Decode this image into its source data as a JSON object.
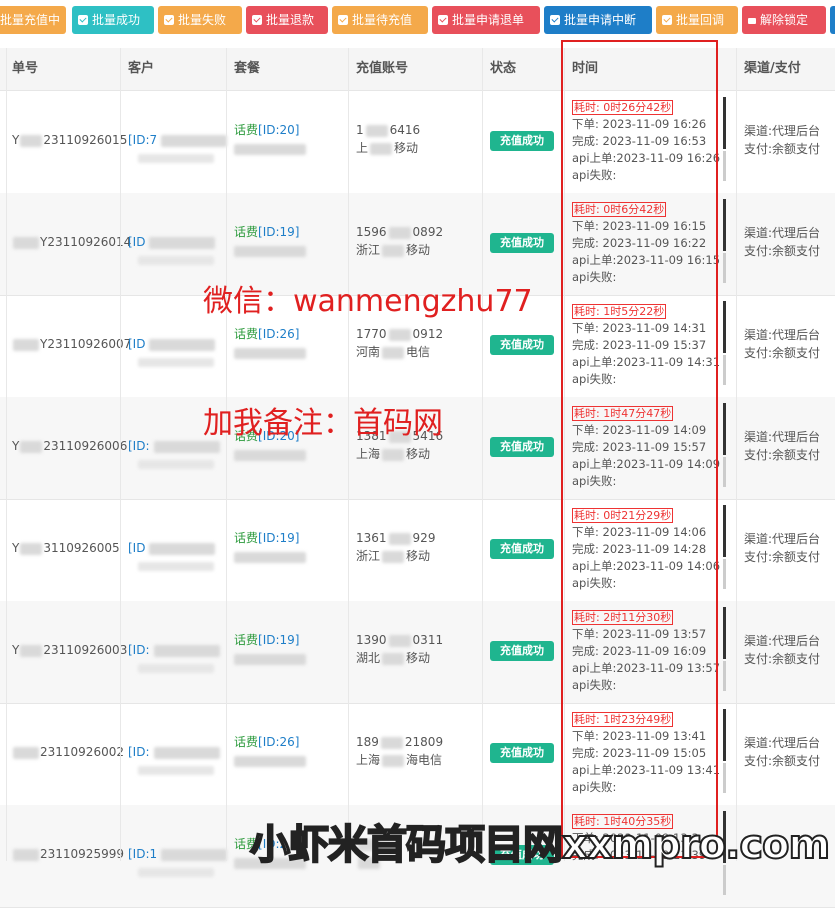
{
  "toolbar": {
    "buttons": [
      {
        "label": "批量充值中",
        "color": "#f4a94a",
        "icon": "check-icon"
      },
      {
        "label": "批量成功",
        "color": "#2ec0c4",
        "icon": "check-icon"
      },
      {
        "label": "批量失败",
        "color": "#f4a94a",
        "icon": "check-icon"
      },
      {
        "label": "批量退款",
        "color": "#e8505b",
        "icon": "check-icon"
      },
      {
        "label": "批量待充值",
        "color": "#f4a94a",
        "icon": "check-icon"
      },
      {
        "label": "批量申请退单",
        "color": "#e8505b",
        "icon": "check-icon"
      },
      {
        "label": "批量申请中断",
        "color": "#1e7ec8",
        "icon": "check-icon"
      },
      {
        "label": "批量回调",
        "color": "#f4a94a",
        "icon": "check-icon"
      },
      {
        "label": "解除锁定",
        "color": "#e8505b",
        "icon": "unlock-icon"
      }
    ]
  },
  "columns": [
    "单号",
    "客户",
    "套餐",
    "充值账号",
    "状态",
    "时间",
    "渠道/支付"
  ],
  "rows": [
    {
      "order_prefix": "Y",
      "order_suffix": "23110926015",
      "customer": "[ID:7",
      "pkg_type": "话费",
      "pkg_id": "[ID:20]",
      "acct1_a": "1",
      "acct1_b": "6",
      "acct1_c": "416",
      "acct2_a": "上",
      "acct2_b": "移动",
      "status": "充值成功",
      "duration": "耗时: 0时26分42秒",
      "order_time": "下单: 2023-11-09 16:26",
      "done_time": "完成: 2023-11-09 16:53",
      "api_time": "api上单:2023-11-09 16:26",
      "api_fail": "api失败:",
      "channel": "渠道:代理后台",
      "pay": "支付:余额支付"
    },
    {
      "order_prefix": "",
      "order_suffix": "Y23110926014",
      "customer": "[ID",
      "pkg_type": "话费",
      "pkg_id": "[ID:19]",
      "acct1_a": "1596",
      "acct1_b": "",
      "acct1_c": "0892",
      "acct2_a": "浙江",
      "acct2_b": "移动",
      "status": "充值成功",
      "duration": "耗时: 0时6分42秒",
      "order_time": "下单: 2023-11-09 16:15",
      "done_time": "完成: 2023-11-09 16:22",
      "api_time": "api上单:2023-11-09 16:15",
      "api_fail": "api失败:",
      "channel": "渠道:代理后台",
      "pay": "支付:余额支付"
    },
    {
      "order_prefix": "",
      "order_suffix": "Y23110926007",
      "customer": "[ID",
      "pkg_type": "话费",
      "pkg_id": "[ID:26]",
      "acct1_a": "1770",
      "acct1_b": "",
      "acct1_c": "0912",
      "acct2_a": "河南",
      "acct2_b": "电信",
      "status": "充值成功",
      "duration": "耗时: 1时5分22秒",
      "order_time": "下单: 2023-11-09 14:31",
      "done_time": "完成: 2023-11-09 15:37",
      "api_time": "api上单:2023-11-09 14:31",
      "api_fail": "api失败:",
      "channel": "渠道:代理后台",
      "pay": "支付:余额支付"
    },
    {
      "order_prefix": "Y",
      "order_suffix": "23110926006",
      "customer": "[ID:",
      "pkg_type": "话费",
      "pkg_id": "[ID:20]",
      "acct1_a": "1381",
      "acct1_b": "",
      "acct1_c": "5416",
      "acct2_a": "上海",
      "acct2_b": "移动",
      "status": "充值成功",
      "duration": "耗时: 1时47分47秒",
      "order_time": "下单: 2023-11-09 14:09",
      "done_time": "完成: 2023-11-09 15:57",
      "api_time": "api上单:2023-11-09 14:09",
      "api_fail": "api失败:",
      "channel": "渠道:代理后台",
      "pay": "支付:余额支付"
    },
    {
      "order_prefix": "Y",
      "order_suffix": "3110926005",
      "customer": "[ID",
      "pkg_type": "话费",
      "pkg_id": "[ID:19]",
      "acct1_a": "1361",
      "acct1_b": "",
      "acct1_c": "929",
      "acct2_a": "浙江",
      "acct2_b": "移动",
      "status": "充值成功",
      "duration": "耗时: 0时21分29秒",
      "order_time": "下单: 2023-11-09 14:06",
      "done_time": "完成: 2023-11-09 14:28",
      "api_time": "api上单:2023-11-09 14:06",
      "api_fail": "api失败:",
      "channel": "渠道:代理后台",
      "pay": "支付:余额支付"
    },
    {
      "order_prefix": "Y",
      "order_suffix": "23110926003",
      "customer": "[ID:",
      "pkg_type": "话费",
      "pkg_id": "[ID:19]",
      "acct1_a": "1390",
      "acct1_b": "",
      "acct1_c": "0311",
      "acct2_a": "湖北",
      "acct2_b": "移动",
      "status": "充值成功",
      "duration": "耗时: 2时11分30秒",
      "order_time": "下单: 2023-11-09 13:57",
      "done_time": "完成: 2023-11-09 16:09",
      "api_time": "api上单:2023-11-09 13:57",
      "api_fail": "api失败:",
      "channel": "渠道:代理后台",
      "pay": "支付:余额支付"
    },
    {
      "order_prefix": "",
      "order_suffix": "23110926002",
      "customer": "[ID:",
      "pkg_type": "话费",
      "pkg_id": "[ID:26]",
      "acct1_a": "189",
      "acct1_b": "",
      "acct1_c": "21809",
      "acct2_a": "上海",
      "acct2_b": "海电信",
      "status": "充值成功",
      "duration": "耗时: 1时23分49秒",
      "order_time": "下单: 2023-11-09 13:41",
      "done_time": "完成: 2023-11-09 15:05",
      "api_time": "api上单:2023-11-09 13:41",
      "api_fail": "api失败:",
      "channel": "渠道:代理后台",
      "pay": "支付:余额支付"
    },
    {
      "order_prefix": "",
      "order_suffix": "23110925999",
      "customer": "[ID:1",
      "pkg_type": "话费",
      "pkg_id": "[ID:2",
      "acct1_a": "",
      "acct1_b": "",
      "acct1_c": "",
      "acct2_a": "",
      "acct2_b": "",
      "status": "充值成功",
      "duration": "耗时: 1时40分35秒",
      "order_time": "下单: 2023-11-09 13:3",
      "done_time": "完成: 2023-11-09 13:39",
      "api_time": "",
      "api_fail": "",
      "channel": "",
      "pay": ""
    }
  ],
  "watermarks": {
    "wechat": "微信：wanmengzhu77",
    "note": "加我备注：首码网",
    "site": "小虾米首码项目网xxmpro.com"
  }
}
